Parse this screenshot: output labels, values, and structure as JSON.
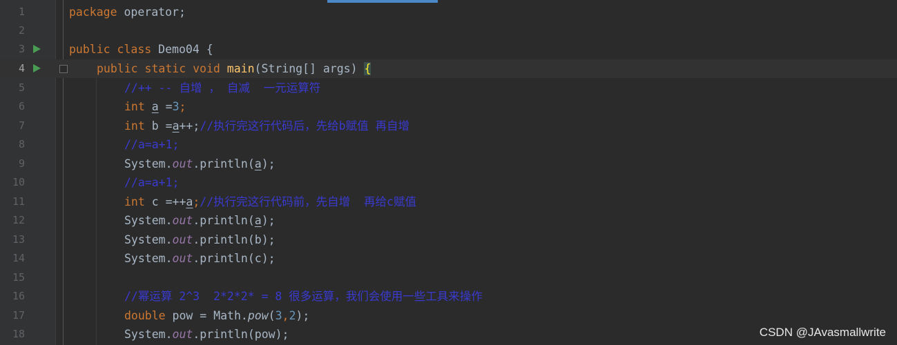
{
  "editor": {
    "lines": [
      {
        "n": "1"
      },
      {
        "n": "2"
      },
      {
        "n": "3"
      },
      {
        "n": "4"
      },
      {
        "n": "5"
      },
      {
        "n": "6"
      },
      {
        "n": "7"
      },
      {
        "n": "8"
      },
      {
        "n": "9"
      },
      {
        "n": "10"
      },
      {
        "n": "11"
      },
      {
        "n": "12"
      },
      {
        "n": "13"
      },
      {
        "n": "14"
      },
      {
        "n": "15"
      },
      {
        "n": "16"
      },
      {
        "n": "17"
      },
      {
        "n": "18"
      }
    ],
    "tokens": {
      "package_kw": "package",
      "package_name": " operator;",
      "public": "public",
      "class": "class",
      "class_name": " Demo04 {",
      "static": "static",
      "void": "void",
      "main": "main",
      "main_params": "(String[] args) ",
      "open_brace": "{",
      "c5": "//++ -- 自增 ， 自减  一元运算符",
      "int": "int",
      "var_a": "a",
      "assign_3_pre": " =",
      "three": "3",
      "semi": ";",
      "b_decl": " b =",
      "a_postinc_tail": "++;",
      "c7": "//执行完这行代码后，先给b赋值 再自增",
      "c8": "//a=a+1;",
      "system": "System.",
      "out": "out",
      "println_open": ".println(",
      "println_close": ");",
      "c10": "//a=a+1;",
      "c_decl": " c =++",
      "c11": "//执行完这行代码前，先自增  再给c赋值",
      "b_arg": "b",
      "c_arg": "c",
      "c16": "//幂运算 2^3  2*2*2* = 8 很多运算，我们会使用一些工具来操作",
      "double": "double",
      "pow_decl": " pow = Math.",
      "pow_fn": "pow",
      "pow_args_open": "(",
      "pow_arg1": "3",
      "comma": ",",
      "pow_arg2": "2",
      "pow_close": ");",
      "pow_arg": "pow"
    }
  },
  "watermark": "CSDN @JAvasmallwrite"
}
